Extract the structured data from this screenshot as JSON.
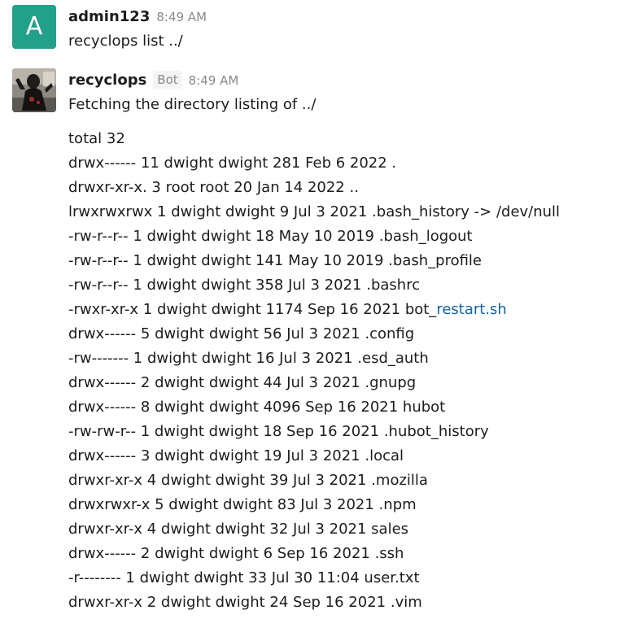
{
  "messages": [
    {
      "username": "admin123",
      "avatar_letter": "A",
      "avatar_color": "#23a08a",
      "timestamp": "8:49 AM",
      "text": "recyclops list ../"
    },
    {
      "username": "recyclops",
      "badge": "Bot",
      "timestamp": "8:49 AM",
      "text": "Fetching the directory listing of ../",
      "listing": [
        "total 32",
        "drwx------ 11 dwight dwight 281 Feb 6 2022 .",
        "drwxr-xr-x. 3 root root 20 Jan 14 2022 ..",
        "lrwxrwxrwx 1 dwight dwight 9 Jul 3 2021 .bash_history -> /dev/null",
        "-rw-r--r-- 1 dwight dwight 18 May 10 2019 .bash_logout",
        "-rw-r--r-- 1 dwight dwight 141 May 10 2019 .bash_profile",
        "-rw-r--r-- 1 dwight dwight 358 Jul 3 2021 .bashrc",
        "-rwxr-xr-x 1 dwight dwight 1174 Sep 16 2021 bot_",
        "drwx------ 5 dwight dwight 56 Jul 3 2021 .config",
        "-rw------- 1 dwight dwight 16 Jul 3 2021 .esd_auth",
        "drwx------ 2 dwight dwight 44 Jul 3 2021 .gnupg",
        "drwx------ 8 dwight dwight 4096 Sep 16 2021 hubot",
        "-rw-rw-r-- 1 dwight dwight 18 Sep 16 2021 .hubot_history",
        "drwx------ 3 dwight dwight 19 Jul 3 2021 .local",
        "drwxr-xr-x 4 dwight dwight 39 Jul 3 2021 .mozilla",
        "drwxrwxr-x 5 dwight dwight 83 Jul 3 2021 .npm",
        "drwxr-xr-x 4 dwight dwight 32 Jul 3 2021 sales",
        "drwx------ 2 dwight dwight 6 Sep 16 2021 .ssh",
        "-r-------- 1 dwight dwight 33 Jul 30 11:04 user.txt",
        "drwxr-xr-x 2 dwight dwight 24 Sep 16 2021 .vim"
      ],
      "link_text": "restart.sh",
      "link_color": "#1264a3"
    }
  ]
}
